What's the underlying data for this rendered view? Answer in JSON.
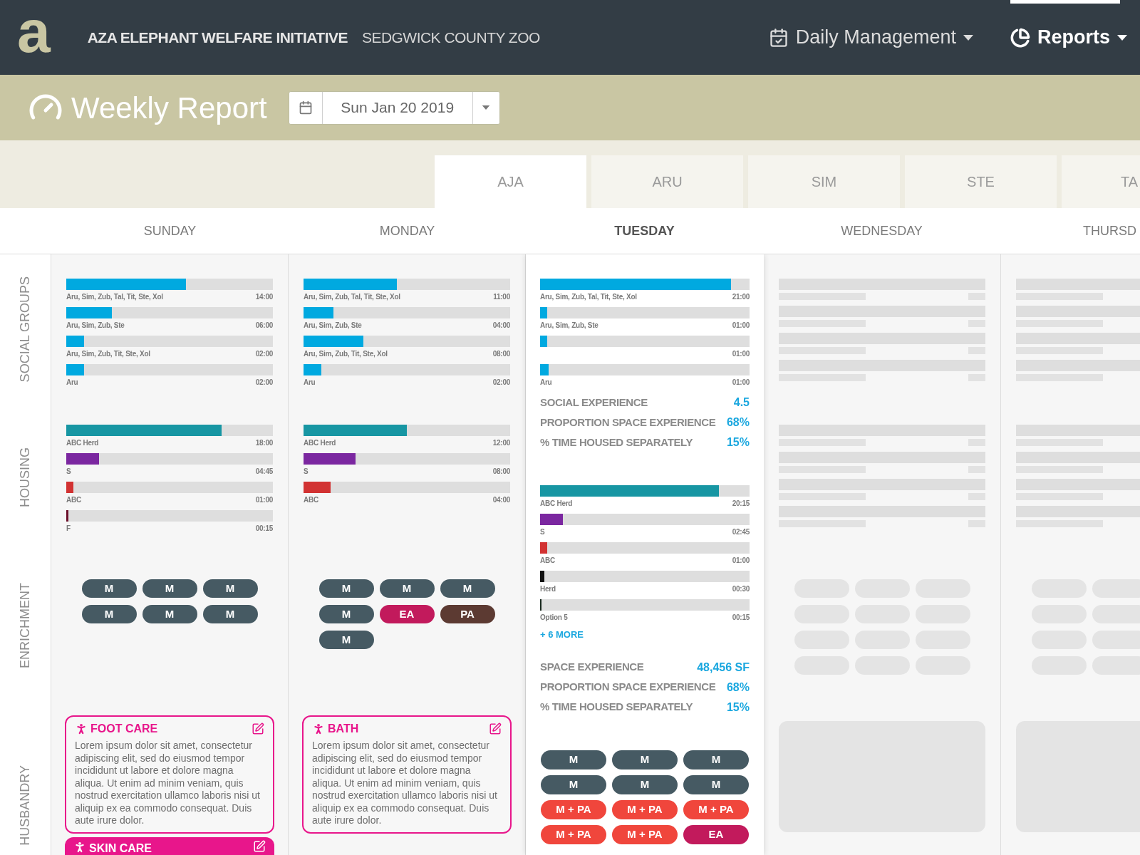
{
  "header": {
    "logo_text": "a",
    "title": "AZA ELEPHANT WELFARE INITIATIVE",
    "subtitle": "SEDGWICK COUNTY ZOO",
    "nav": [
      {
        "label": "Daily Management",
        "kind": "calendar",
        "selected": false
      },
      {
        "label": "Reports",
        "kind": "chart",
        "selected": true
      }
    ]
  },
  "page": {
    "title": "Weekly Report",
    "date": "Sun Jan 20 2019"
  },
  "tabs": [
    {
      "label": "AJA",
      "selected": true
    },
    {
      "label": "ARU",
      "selected": false
    },
    {
      "label": "SIM",
      "selected": false
    },
    {
      "label": "STE",
      "selected": false
    },
    {
      "label": "TA",
      "selected": false
    }
  ],
  "row_labels": [
    "SOCIAL GROUPS",
    "HOUSING",
    "ENRICHMENT",
    "HUSBANDRY"
  ],
  "days": [
    {
      "label": "SUNDAY",
      "selected": false,
      "kind": "report",
      "social": [
        {
          "name": "Aru, Sim, Zub, Tal, Tit, Ste, Xol",
          "time": "14:00",
          "level": 0.58
        },
        {
          "name": "Aru, Sim, Zub, Ste",
          "time": "06:00",
          "level": 0.22
        },
        {
          "name": "Aru, Sim, Zub, Tit, Ste, Xol",
          "time": "02:00",
          "level": 0.085
        },
        {
          "name": "Aru",
          "time": "02:00",
          "level": 0.085
        }
      ],
      "housing": [
        {
          "name": "ABC Herd",
          "time": "18:00",
          "level": 0.75,
          "color": "#1796a3"
        },
        {
          "name": "S",
          "time": "04:45",
          "level": 0.16,
          "color": "#7b27a0"
        },
        {
          "name": "ABC",
          "time": "01:00",
          "level": 0.035,
          "color": "#d23232"
        },
        {
          "name": "F",
          "time": "00:15",
          "level": 0.012,
          "color": "#6b0f2a"
        }
      ],
      "enrichment": [
        {
          "label": "M",
          "kind": "m"
        },
        {
          "label": "M",
          "kind": "m"
        },
        {
          "label": "M",
          "kind": "m"
        },
        {
          "label": "M",
          "kind": "m"
        },
        {
          "label": "M",
          "kind": "m"
        },
        {
          "label": "M",
          "kind": "m"
        }
      ],
      "husbandry": [
        {
          "title": "FOOT CARE",
          "expanded": true,
          "body": "Lorem ipsum dolor sit amet, consectetur adipiscing elit, sed do eiusmod tempor incididunt ut labore et dolore magna aliqua. Ut enim ad minim veniam, quis nostrud exercitation ullamco laboris nisi ut aliquip ex ea commodo consequat. Duis aute irure dolor."
        },
        {
          "title": "SKIN CARE",
          "expanded": false
        }
      ]
    },
    {
      "label": "MONDAY",
      "selected": false,
      "kind": "report",
      "social": [
        {
          "name": "Aru, Sim, Zub, Tal, Tit, Ste, Xol",
          "time": "11:00",
          "level": 0.45
        },
        {
          "name": "Aru, Sim, Zub, Ste",
          "time": "04:00",
          "level": 0.145
        },
        {
          "name": "Aru, Sim, Zub, Tit, Ste, Xol",
          "time": "08:00",
          "level": 0.29
        },
        {
          "name": "Aru",
          "time": "02:00",
          "level": 0.085
        }
      ],
      "housing": [
        {
          "name": "ABC Herd",
          "time": "12:00",
          "level": 0.5,
          "color": "#1796a3"
        },
        {
          "name": "S",
          "time": "08:00",
          "level": 0.25,
          "color": "#7b27a0"
        },
        {
          "name": "ABC",
          "time": "04:00",
          "level": 0.13,
          "color": "#d23232"
        }
      ],
      "enrichment": [
        {
          "label": "M",
          "kind": "m"
        },
        {
          "label": "M",
          "kind": "m"
        },
        {
          "label": "M",
          "kind": "m"
        },
        {
          "label": "M",
          "kind": "m"
        },
        {
          "label": "EA",
          "kind": "ea"
        },
        {
          "label": "PA",
          "kind": "pa"
        },
        {
          "label": "M",
          "kind": "m"
        }
      ],
      "husbandry": [
        {
          "title": "BATH",
          "expanded": true,
          "body": "Lorem ipsum dolor sit amet, consectetur adipiscing elit, sed do eiusmod tempor incididunt ut labore et dolore magna aliqua. Ut enim ad minim veniam, quis nostrud exercitation ullamco laboris nisi ut aliquip ex ea commodo consequat. Duis aute irure dolor."
        }
      ]
    },
    {
      "label": "TUESDAY",
      "selected": true,
      "kind": "report",
      "social": [
        {
          "name": "Aru, Sim, Zub, Tal, Tit, Ste, Xol",
          "time": "21:00",
          "level": 0.91
        },
        {
          "name": "Aru, Sim, Zub, Ste",
          "time": "01:00",
          "level": 0.035
        },
        {
          "time": "01:00",
          "level": 0.035
        },
        {
          "name": "Aru",
          "time": "01:00",
          "level": 0.042
        }
      ],
      "social_stats": [
        {
          "label": "SOCIAL EXPERIENCE",
          "value": "4.5"
        },
        {
          "label": "PROPORTION SPACE EXPERIENCE",
          "value": "68%"
        },
        {
          "label": "% TIME HOUSED SEPARATELY",
          "value": "15%"
        }
      ],
      "housing": [
        {
          "name": "ABC Herd",
          "time": "20:15",
          "level": 0.855,
          "color": "#1796a3"
        },
        {
          "name": "S",
          "time": "02:45",
          "level": 0.11,
          "color": "#7b27a0"
        },
        {
          "name": "ABC",
          "time": "01:00",
          "level": 0.035,
          "color": "#d23232"
        },
        {
          "name": "Herd",
          "time": "00:30",
          "level": 0.02,
          "color": "#111111"
        },
        {
          "name": "Option 5",
          "time": "00:15",
          "level": 0.007,
          "color": "#1a2a20"
        }
      ],
      "housing_more": "+ 6 MORE",
      "housing_stats": [
        {
          "label": "SPACE EXPERIENCE",
          "value": "48,456 SF"
        },
        {
          "label": "PROPORTION SPACE EXPERIENCE",
          "value": "68%"
        },
        {
          "label": "% TIME HOUSED SEPARATELY",
          "value": "15%"
        }
      ],
      "enrichment": [
        {
          "label": "M",
          "kind": "m"
        },
        {
          "label": "M",
          "kind": "m"
        },
        {
          "label": "M",
          "kind": "m"
        },
        {
          "label": "M",
          "kind": "m"
        },
        {
          "label": "M",
          "kind": "m"
        },
        {
          "label": "M",
          "kind": "m"
        },
        {
          "label": "M + PA",
          "kind": "mpa"
        },
        {
          "label": "M + PA",
          "kind": "mpa"
        },
        {
          "label": "M + PA",
          "kind": "mpa"
        },
        {
          "label": "M + PA",
          "kind": "mpa"
        },
        {
          "label": "M + PA",
          "kind": "mpa"
        },
        {
          "label": "EA",
          "kind": "ea"
        }
      ]
    },
    {
      "label": "WEDNESDAY",
      "selected": false,
      "kind": "placeholder"
    },
    {
      "label": "THURSD",
      "selected": false,
      "kind": "placeholder"
    }
  ]
}
